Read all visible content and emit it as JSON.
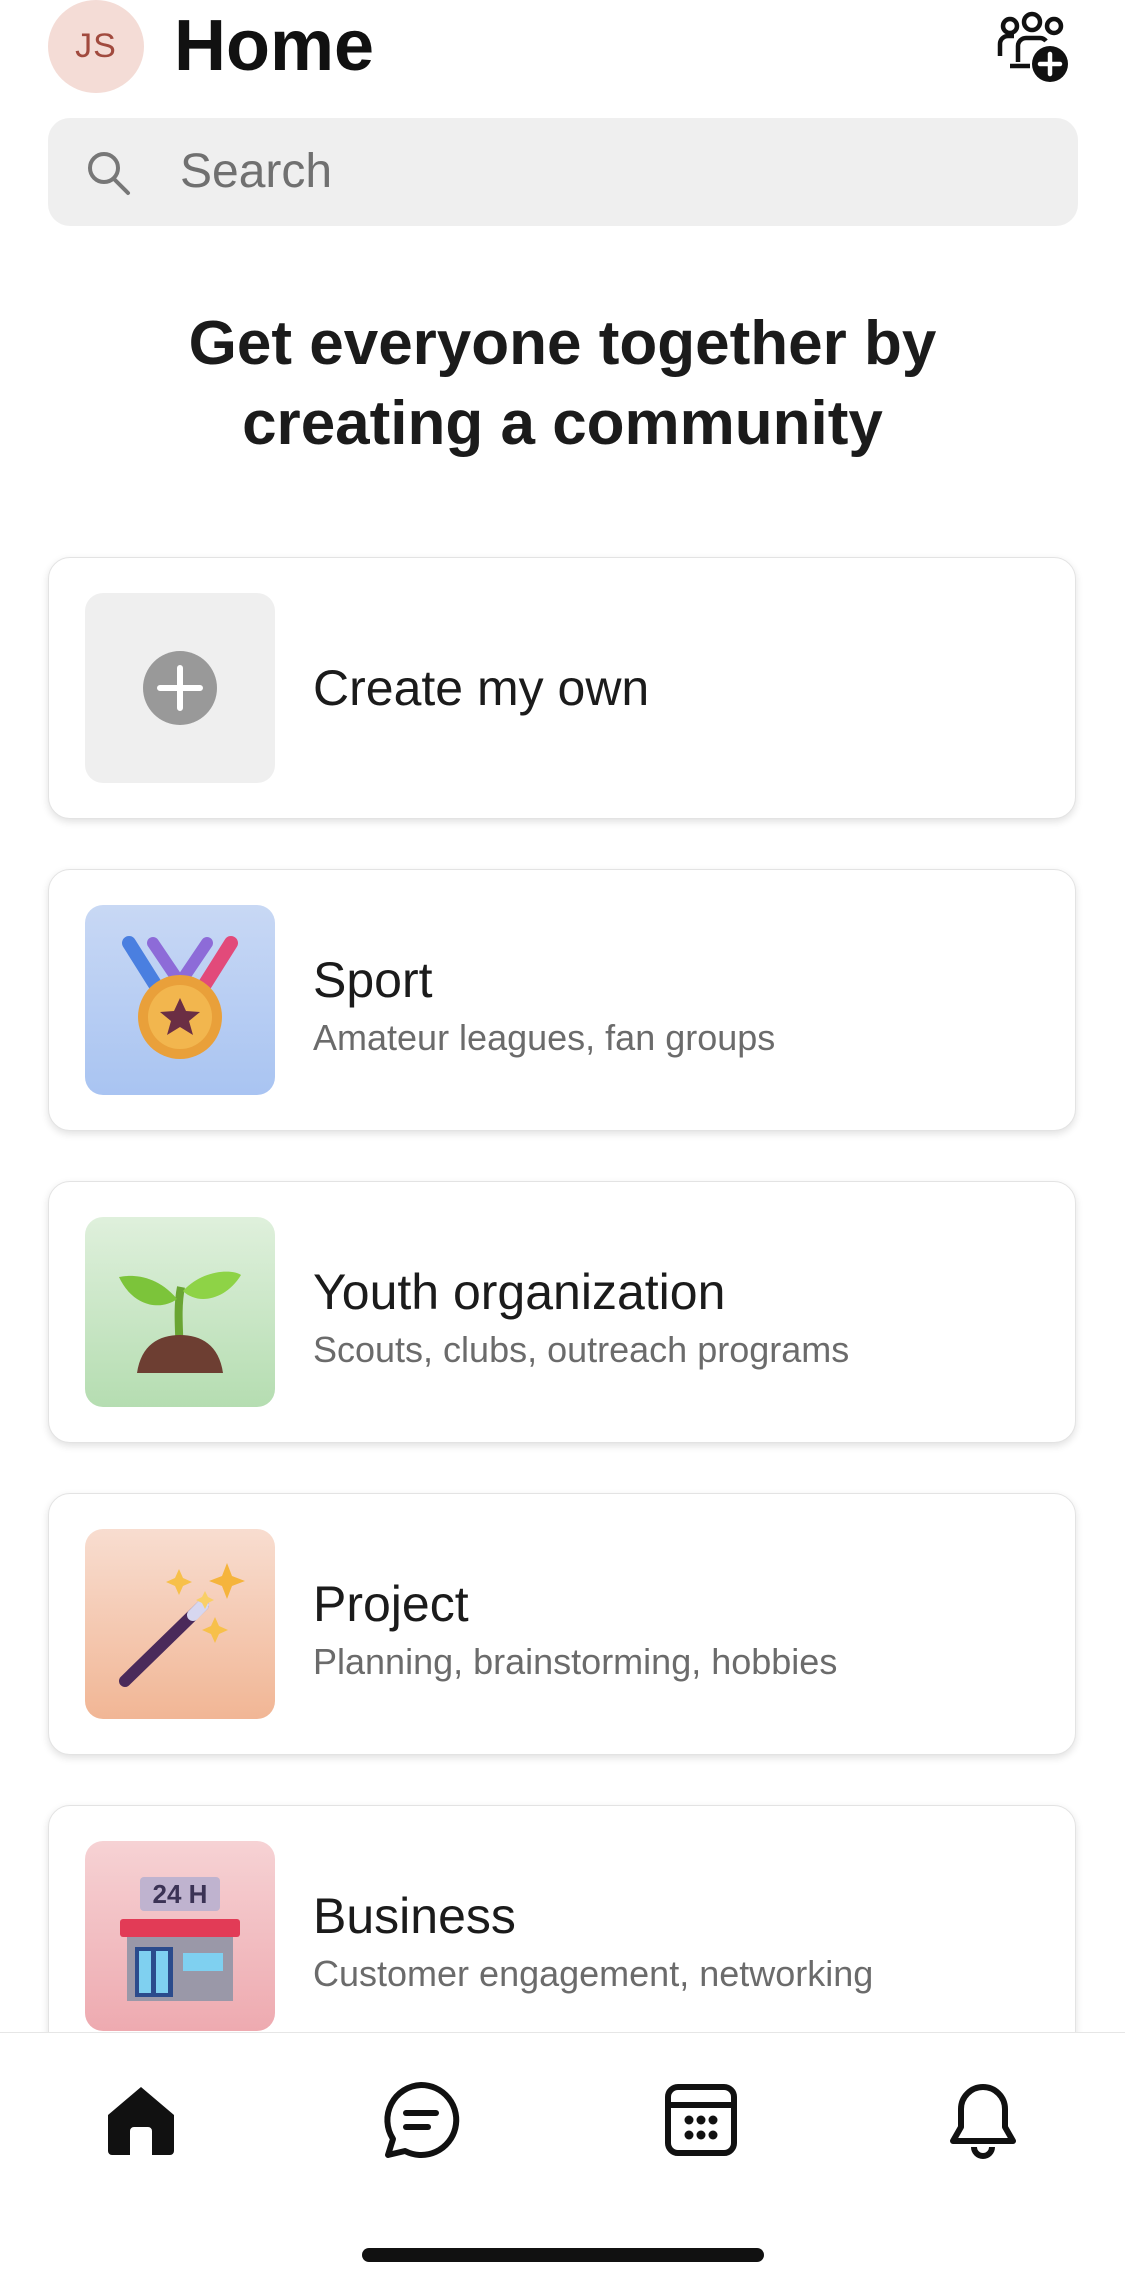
{
  "header": {
    "avatar_initials": "JS",
    "title": "Home",
    "community_icon": "people-add-icon"
  },
  "search": {
    "placeholder": "Search",
    "icon": "search-icon"
  },
  "headline": {
    "line1": "Get everyone together by",
    "line2": "creating a community"
  },
  "cards": [
    {
      "name": "Create my own",
      "description": "",
      "icon": "plus-icon"
    },
    {
      "name": "Sport",
      "description": "Amateur leagues, fan groups",
      "icon": "medal-icon"
    },
    {
      "name": "Youth organization",
      "description": "Scouts, clubs, outreach programs",
      "icon": "seedling-icon"
    },
    {
      "name": "Project",
      "description": "Planning, brainstorming, hobbies",
      "icon": "magic-wand-icon"
    },
    {
      "name": "Business",
      "description": "Customer engagement, networking",
      "icon": "store-24h-icon",
      "store_sign": "24 H"
    }
  ],
  "bottom_nav": [
    {
      "name": "home",
      "icon": "home-icon",
      "active": true
    },
    {
      "name": "chat",
      "icon": "chat-icon",
      "active": false
    },
    {
      "name": "calendar",
      "icon": "calendar-icon",
      "active": false
    },
    {
      "name": "notifications",
      "icon": "bell-icon",
      "active": false
    }
  ],
  "colors": {
    "avatar_bg": "#f4dcd6",
    "avatar_text": "#a14a3e",
    "search_bg": "#efefef",
    "text_primary": "#1b1b1b",
    "text_secondary": "#6b6b6b"
  }
}
